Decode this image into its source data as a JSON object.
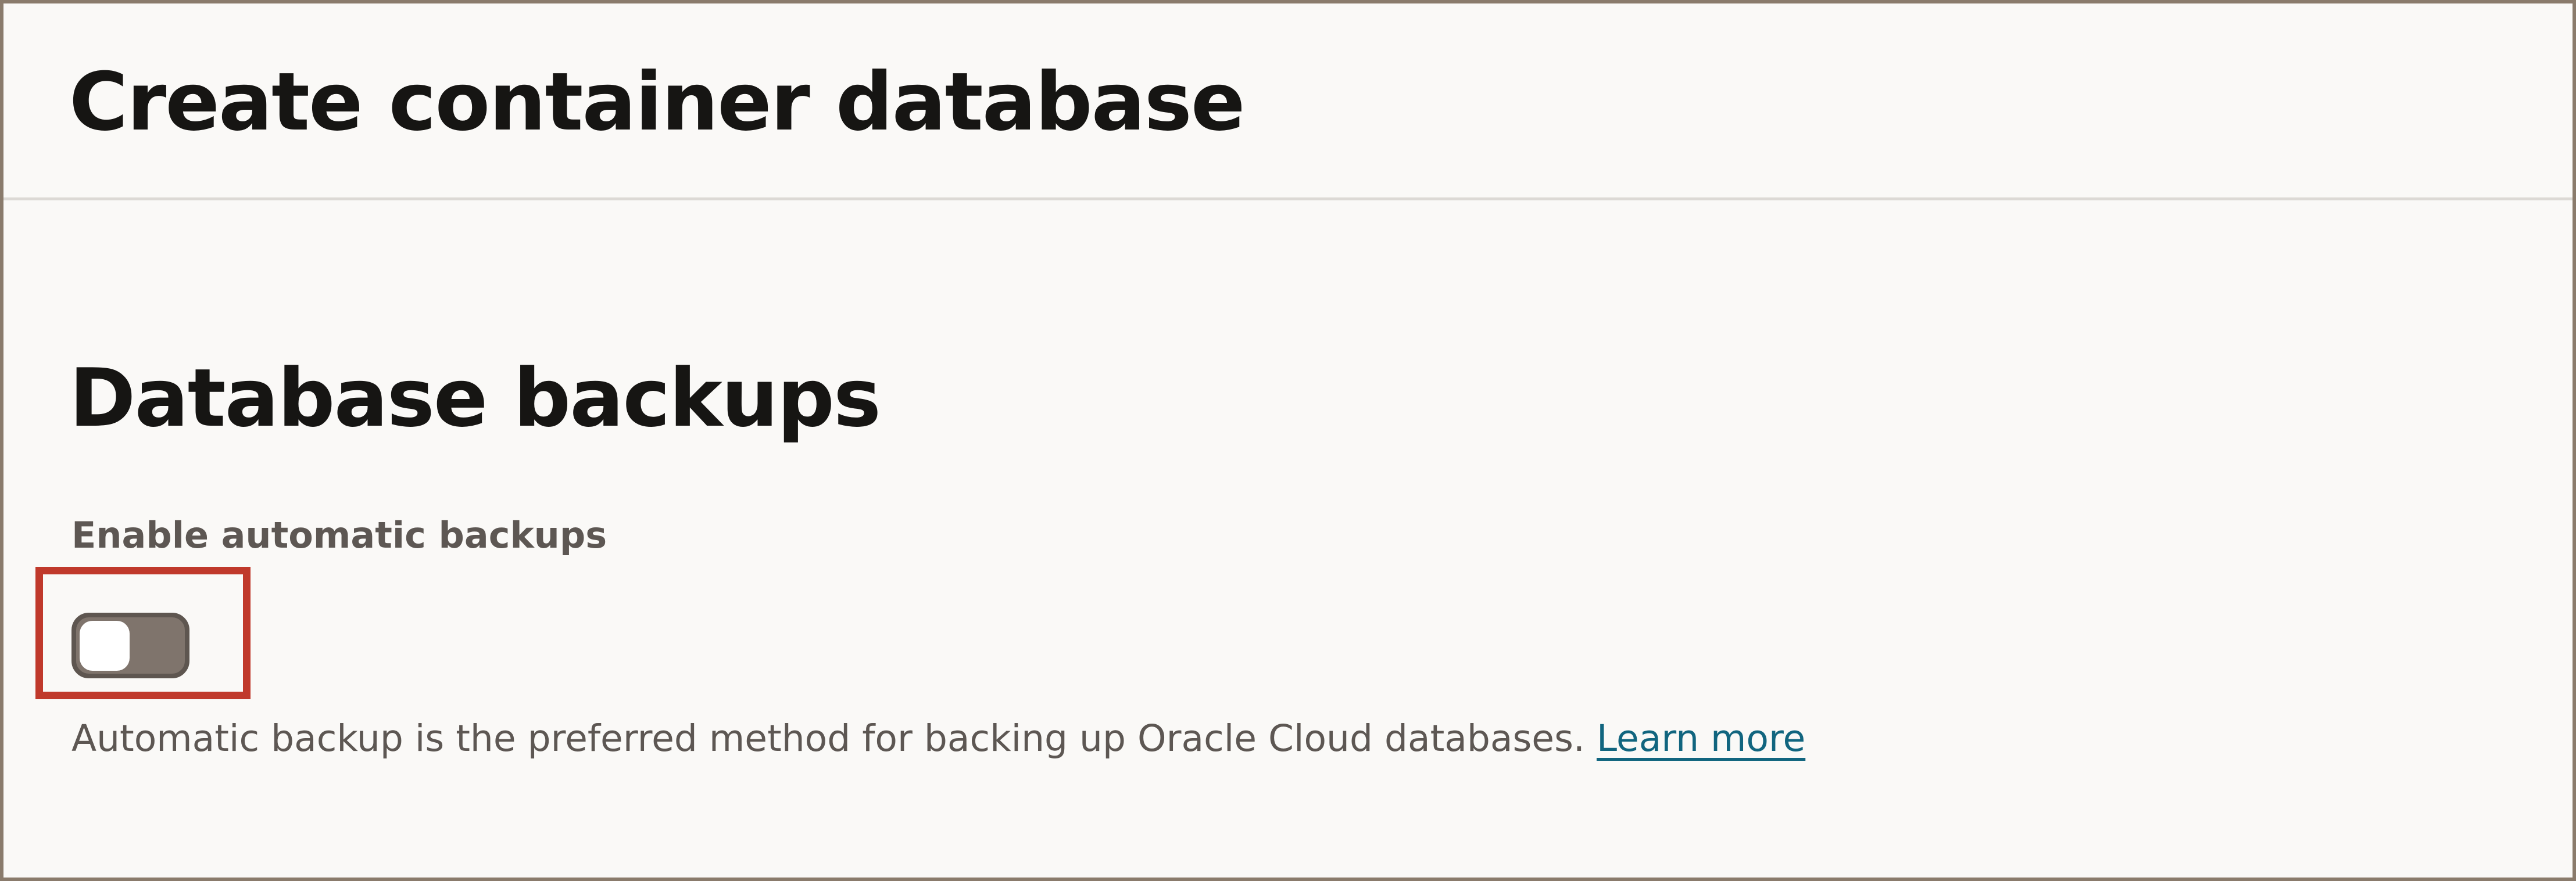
{
  "dialog": {
    "title": "Create container database"
  },
  "section": {
    "title": "Database backups",
    "backup_toggle": {
      "label": "Enable automatic backups",
      "enabled": false
    },
    "help_text": "Automatic backup is the preferred method for backing up Oracle Cloud databases.",
    "learn_more_link": "Learn more"
  },
  "colors": {
    "highlight": "#c0392b",
    "link": "#11657f",
    "toggle_off": "#7f746c",
    "background": "#faf9f7"
  }
}
